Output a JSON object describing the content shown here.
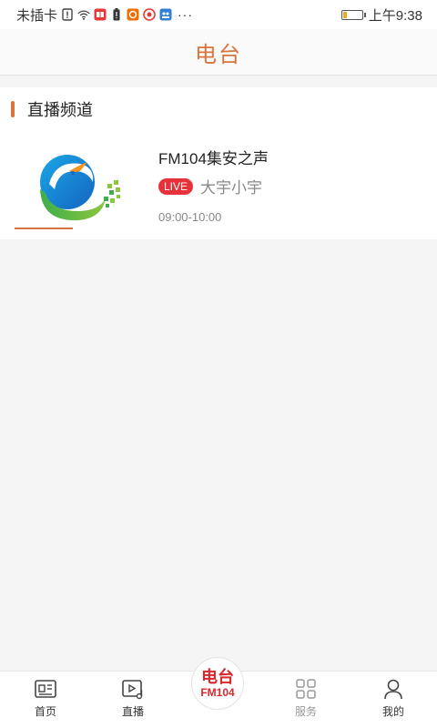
{
  "status_bar": {
    "carrier": "未插卡",
    "time": "上午9:38",
    "more": "···",
    "icons": [
      "sim-alert-icon",
      "wifi-icon",
      "red-app-icon",
      "battery-alert-icon",
      "orange-app-icon",
      "red-swirl-icon",
      "blue-app-icon"
    ],
    "battery_level": 0.2,
    "battery_color": "#f5a623"
  },
  "header": {
    "title": "电台"
  },
  "section": {
    "title": "直播频道"
  },
  "channel": {
    "name": "FM104集安之声",
    "live_badge": "LIVE",
    "program": "大宇小宇",
    "time": "09:00-10:00",
    "logo_icon": "radio-station-logo"
  },
  "bottom_nav": {
    "items": [
      {
        "label": "首页",
        "icon": "news-icon"
      },
      {
        "label": "直播",
        "icon": "play-video-icon"
      },
      {
        "label": "服务",
        "icon": "grid-icon"
      },
      {
        "label": "我的",
        "icon": "user-icon"
      }
    ],
    "center": {
      "title": "电台",
      "sub": "FM104"
    }
  },
  "colors": {
    "accent": "#d8743c",
    "live": "#e8323a",
    "center": "#d8282e"
  }
}
